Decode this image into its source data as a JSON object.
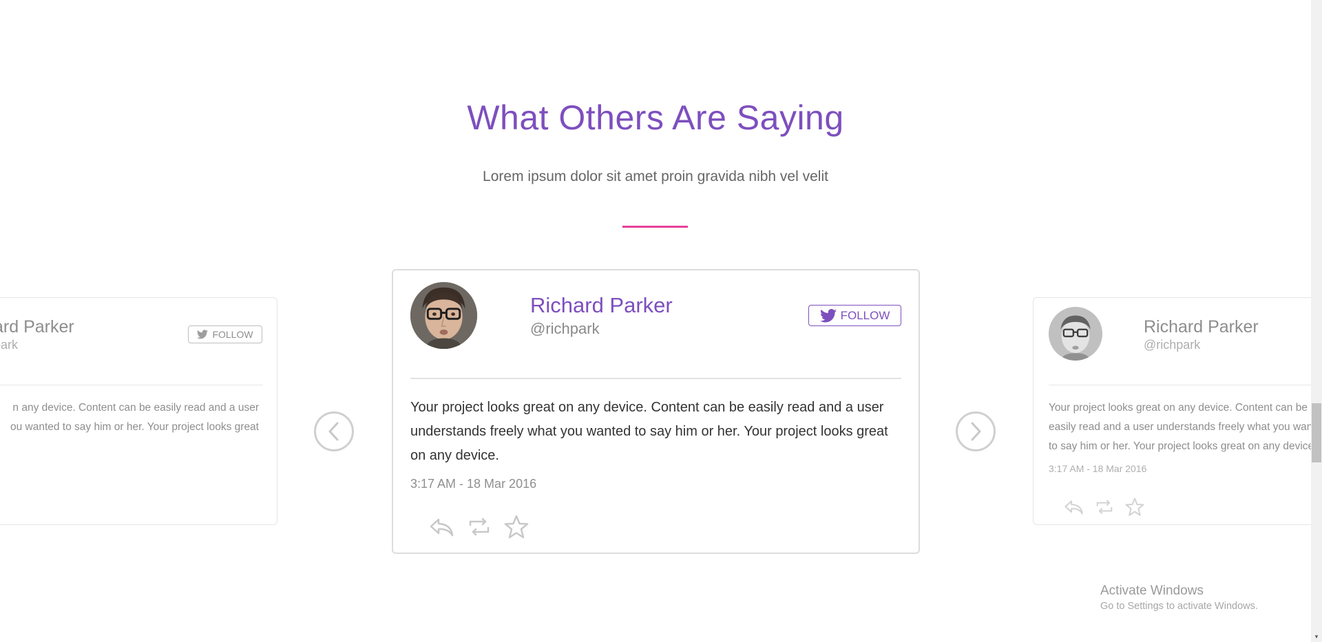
{
  "section": {
    "title": "What Others Are Saying",
    "subtitle": "Lorem ipsum dolor sit amet proin gravida nibh vel velit",
    "divider_color": "#e5409a",
    "title_color": "#7d4fbe"
  },
  "main_card": {
    "name": "Richard Parker",
    "handle": "@richpark",
    "follow_label": "FOLLOW",
    "text": "Your project looks great on any device. Content can be easily read and a user understands freely what you wanted to say him or her. Your project looks great on any device.",
    "time": "3:17 AM - 18 Mar 2016",
    "follow_icon": "twitter-icon",
    "action_icons": [
      "reply-icon",
      "retweet-icon",
      "star-icon"
    ]
  },
  "left_card": {
    "name": "ard Parker",
    "handle": "park",
    "follow_label": "FOLLOW",
    "text_line1": "n any device. Content can be easily read and a user",
    "text_line2": "ou wanted to say him or her. Your project looks great"
  },
  "right_card": {
    "name": "Richard Parker",
    "handle": "@richpark",
    "text": "Your project looks great on any device. Content can be easily read and a user understands freely what you wanted to say him or her. Your project looks great on any device.",
    "time": "3:17 AM - 18 Mar 2016"
  },
  "navigation": {
    "prev_icon": "chevron-left-icon",
    "next_icon": "chevron-right-icon"
  },
  "watermark": {
    "title": "Activate Windows",
    "subtitle": "Go to Settings to activate Windows."
  }
}
